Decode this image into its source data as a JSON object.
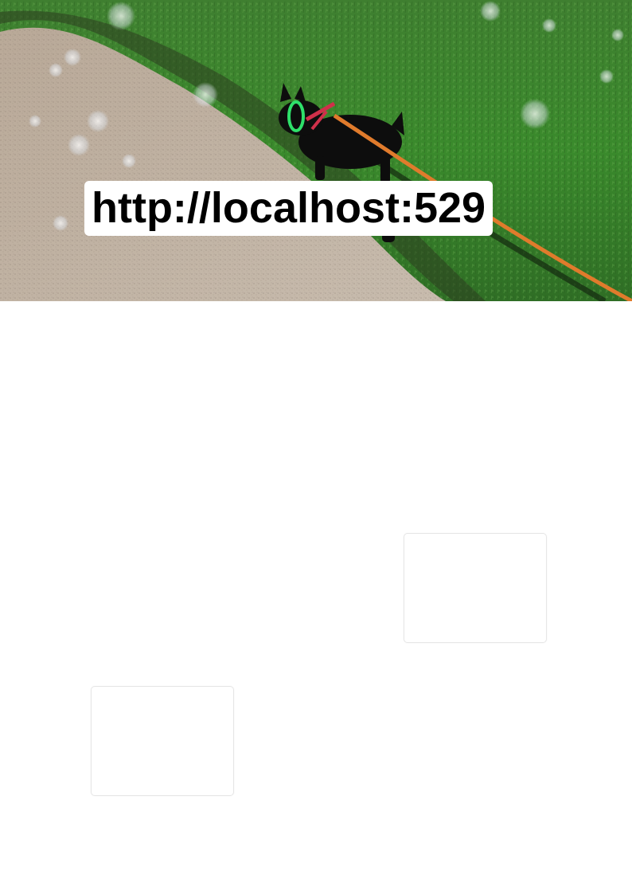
{
  "page": {
    "url_text": "http://localhost:529"
  },
  "hero_image": {
    "subject": "black-dog-on-leash",
    "colors": {
      "grass": "#3d7a2e",
      "path": "#b8aa98",
      "leash": "#e07b2c",
      "collar": "#2ee06a"
    }
  },
  "cards": [
    {
      "id": "card-a"
    },
    {
      "id": "card-b"
    }
  ]
}
